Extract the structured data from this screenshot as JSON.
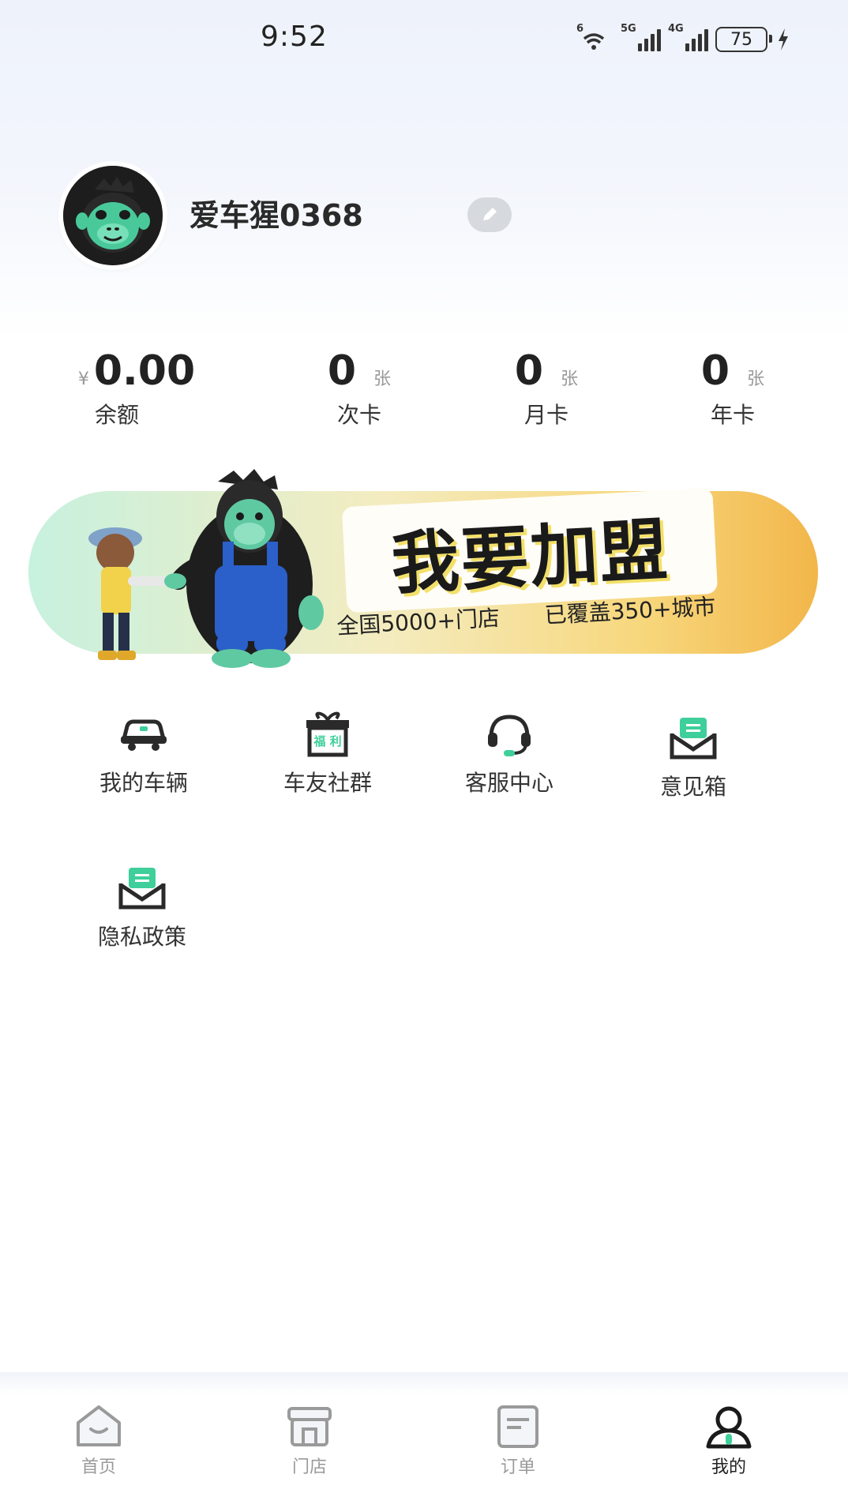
{
  "status_bar": {
    "time": "9:52",
    "wifi_label": "6",
    "sim1_label": "5G",
    "sim2_label": "4G",
    "battery": "75"
  },
  "profile": {
    "name": "爱车猩0368"
  },
  "stats": [
    {
      "currency": "¥",
      "value": "0.00",
      "label": "余额"
    },
    {
      "value": "0",
      "unit": "张",
      "label": "次卡"
    },
    {
      "value": "0",
      "unit": "张",
      "label": "月卡"
    },
    {
      "value": "0",
      "unit": "张",
      "label": "年卡"
    }
  ],
  "banner": {
    "title": "我要加盟",
    "sub1": "全国5000+门店",
    "sub2": "已覆盖350+城市"
  },
  "menu": [
    {
      "label": "我的车辆",
      "icon": "car-icon"
    },
    {
      "label": "车友社群",
      "icon": "gift-icon",
      "icon_text": "福 利"
    },
    {
      "label": "客服中心",
      "icon": "headset-icon"
    },
    {
      "label": "意见箱",
      "icon": "mail-icon"
    },
    {
      "label": "隐私政策",
      "icon": "mail-icon"
    }
  ],
  "bottom_nav": [
    {
      "label": "首页",
      "icon": "home-icon",
      "active": false
    },
    {
      "label": "门店",
      "icon": "store-icon",
      "active": false
    },
    {
      "label": "订单",
      "icon": "order-icon",
      "active": false
    },
    {
      "label": "我的",
      "icon": "profile-icon",
      "active": true
    }
  ],
  "colors": {
    "accent": "#3ecf9a",
    "banner_orange": "#f2b64a",
    "text_dark": "#222222",
    "text_muted": "#9a9a9a"
  }
}
